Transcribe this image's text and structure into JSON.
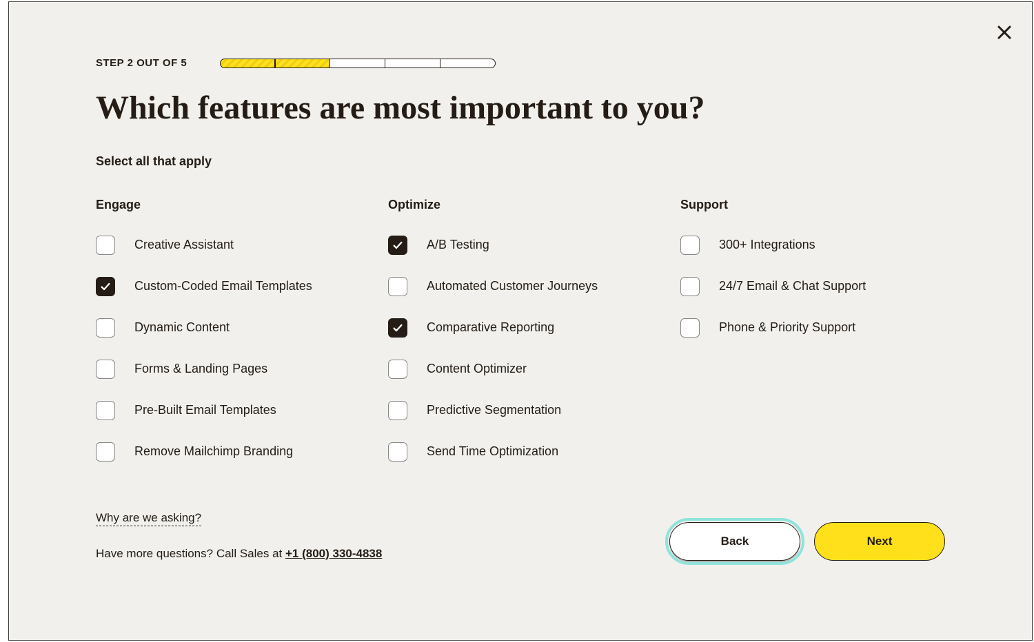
{
  "step": {
    "label": "STEP 2 OUT OF 5",
    "current": 2,
    "total": 5
  },
  "title": "Which features are most important to you?",
  "instruction": "Select all that apply",
  "columns": [
    {
      "header": "Engage",
      "options": [
        {
          "label": "Creative Assistant",
          "checked": false,
          "id": "creative-assistant"
        },
        {
          "label": "Custom-Coded Email Templates",
          "checked": true,
          "id": "custom-coded-email-templates"
        },
        {
          "label": "Dynamic Content",
          "checked": false,
          "id": "dynamic-content"
        },
        {
          "label": "Forms & Landing Pages",
          "checked": false,
          "id": "forms-landing-pages"
        },
        {
          "label": "Pre-Built Email Templates",
          "checked": false,
          "id": "pre-built-email-templates"
        },
        {
          "label": "Remove Mailchimp Branding",
          "checked": false,
          "id": "remove-mailchimp-branding"
        }
      ]
    },
    {
      "header": "Optimize",
      "options": [
        {
          "label": "A/B Testing",
          "checked": true,
          "id": "ab-testing"
        },
        {
          "label": "Automated Customer Journeys",
          "checked": false,
          "id": "automated-customer-journeys"
        },
        {
          "label": "Comparative Reporting",
          "checked": true,
          "id": "comparative-reporting"
        },
        {
          "label": "Content Optimizer",
          "checked": false,
          "id": "content-optimizer"
        },
        {
          "label": "Predictive Segmentation",
          "checked": false,
          "id": "predictive-segmentation"
        },
        {
          "label": "Send Time Optimization",
          "checked": false,
          "id": "send-time-optimization"
        }
      ]
    },
    {
      "header": "Support",
      "options": [
        {
          "label": "300+ Integrations",
          "checked": false,
          "id": "300-integrations"
        },
        {
          "label": "24/7 Email & Chat Support",
          "checked": false,
          "id": "email-chat-support"
        },
        {
          "label": "Phone & Priority Support",
          "checked": false,
          "id": "phone-priority-support"
        }
      ]
    }
  ],
  "footer": {
    "whyLink": "Why are we asking?",
    "salesPrefix": "Have more questions? Call Sales at ",
    "salesPhone": "+1 (800) 330-4838",
    "backLabel": "Back",
    "nextLabel": "Next"
  },
  "colors": {
    "accent": "#ffe01b",
    "text": "#241c15",
    "focusRing": "#8fe3dc",
    "background": "#f1f0ec"
  }
}
